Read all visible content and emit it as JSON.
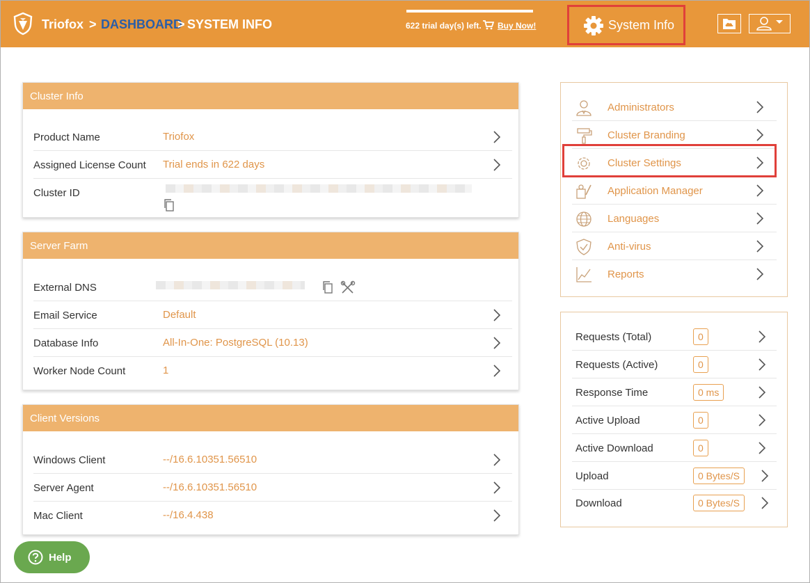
{
  "header": {
    "brand": "Triofox",
    "sep1": ">",
    "dashboard_link": "DASHBOARD",
    "sep2": ">",
    "current": "SYSTEM INFO",
    "trial_text": "622 trial day(s) left.",
    "buy_now": "Buy Now!",
    "system_info": "System Info",
    "colors": {
      "bar": "#e8973a",
      "breadcrumb_link": "#2b5ea7"
    }
  },
  "cluster_info": {
    "title": "Cluster Info",
    "rows": [
      {
        "label": "Product Name",
        "value": "Triofox"
      },
      {
        "label": "Assigned License Count",
        "value": "Trial ends in 622 days"
      },
      {
        "label": "Cluster ID",
        "value": ""
      }
    ]
  },
  "server_farm": {
    "title": "Server Farm",
    "rows": [
      {
        "label": "External DNS",
        "value": ""
      },
      {
        "label": "Email Service",
        "value": "Default"
      },
      {
        "label": "Database Info",
        "value": "All-In-One: PostgreSQL (10.13)"
      },
      {
        "label": "Worker Node Count",
        "value": "1"
      }
    ]
  },
  "client_versions": {
    "title": "Client Versions",
    "rows": [
      {
        "label": "Windows Client",
        "value": "--/16.6.10351.56510"
      },
      {
        "label": "Server Agent",
        "value": "--/16.6.10351.56510"
      },
      {
        "label": "Mac Client",
        "value": "--/16.4.438"
      }
    ]
  },
  "menu": [
    {
      "label": "Administrators",
      "icon": "admin-user-icon"
    },
    {
      "label": "Cluster Branding",
      "icon": "paint-roller-icon"
    },
    {
      "label": "Cluster Settings",
      "icon": "gear-icon"
    },
    {
      "label": "Application Manager",
      "icon": "app-manager-icon"
    },
    {
      "label": "Languages",
      "icon": "globe-icon"
    },
    {
      "label": "Anti-virus",
      "icon": "shield-check-icon"
    },
    {
      "label": "Reports",
      "icon": "chart-icon"
    }
  ],
  "stats": [
    {
      "label": "Requests (Total)",
      "value": "0"
    },
    {
      "label": "Requests (Active)",
      "value": "0"
    },
    {
      "label": "Response Time",
      "value": "0 ms"
    },
    {
      "label": "Active Upload",
      "value": "0"
    },
    {
      "label": "Active Download",
      "value": "0"
    },
    {
      "label": "Upload",
      "value": "0 Bytes/S"
    },
    {
      "label": "Download",
      "value": "0 Bytes/S"
    }
  ],
  "help": {
    "label": "Help",
    "color": "#6aa84f"
  },
  "accent_color": "#e0954a"
}
